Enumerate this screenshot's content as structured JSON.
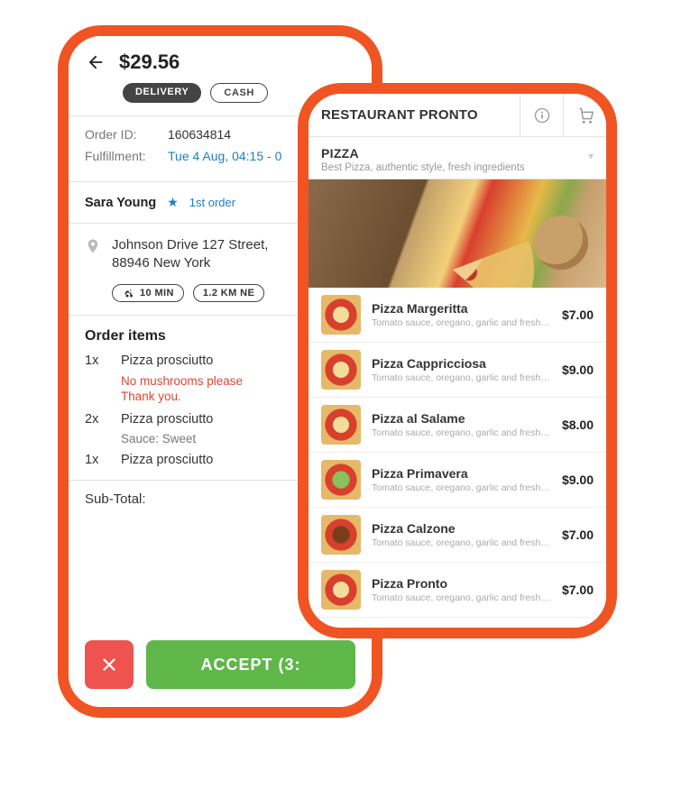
{
  "order": {
    "total": "$29.56",
    "chips": {
      "delivery": "DELIVERY",
      "payment": "CASH"
    },
    "meta": {
      "id_label": "Order ID:",
      "id_value": "160634814",
      "fulfillment_label": "Fulfillment:",
      "fulfillment_value": "Tue 4 Aug, 04:15 - 0"
    },
    "customer": {
      "name": "Sara Young",
      "first_order_label": "1st order"
    },
    "address": {
      "line1": "Johnson Drive 127 Street,",
      "line2": "88946 New York",
      "eta_label": "10 MIN",
      "distance_label": "1.2 KM NE"
    },
    "items_title": "Order items",
    "items": [
      {
        "qty": "1x",
        "name": "Pizza prosciutto",
        "note": "No mushrooms please\nThank you."
      },
      {
        "qty": "2x",
        "name": "Pizza prosciutto",
        "sub": "Sauce: Sweet"
      },
      {
        "qty": "1x",
        "name": "Pizza prosciutto"
      }
    ],
    "subtotal_label": "Sub-Total:",
    "accept_label": "ACCEPT (3:"
  },
  "menu": {
    "restaurant": "RESTAURANT PRONTO",
    "category": {
      "name": "PIZZA",
      "desc": "Best Pizza, authentic style, fresh ingredients"
    },
    "items": [
      {
        "name": "Pizza Margeritta",
        "desc": "Tomato sauce, oregano, garlic and fresh brasil",
        "price": "$7.00"
      },
      {
        "name": "Pizza Cappricciosa",
        "desc": "Tomato sauce, oregano, garlic and fresh brasil",
        "price": "$9.00"
      },
      {
        "name": "Pizza al Salame",
        "desc": "Tomato sauce, oregano, garlic and fresh brasil",
        "price": "$8.00"
      },
      {
        "name": "Pizza Primavera",
        "desc": "Tomato sauce, oregano, garlic and fresh brasil",
        "price": "$9.00"
      },
      {
        "name": "Pizza Calzone",
        "desc": "Tomato sauce, oregano, garlic and fresh brasil",
        "price": "$7.00"
      },
      {
        "name": "Pizza Pronto",
        "desc": "Tomato sauce, oregano, garlic and fresh brasil",
        "price": "$7.00"
      }
    ]
  }
}
